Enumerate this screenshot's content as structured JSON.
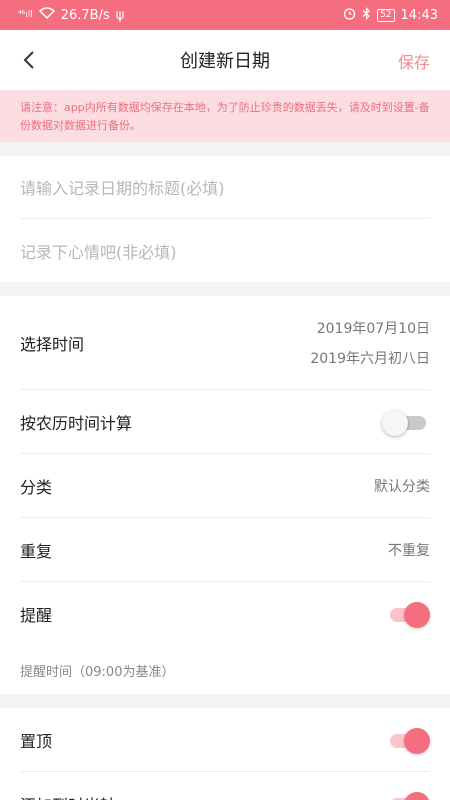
{
  "status_bar": {
    "signal": "⁴⁶ıll",
    "speed": "26.7B/s",
    "usb": "ψ",
    "battery": "52",
    "time": "14:43"
  },
  "app_bar": {
    "title": "创建新日期",
    "save_label": "保存"
  },
  "notice": {
    "text": "请注意：app内所有数据均保存在本地，为了防止珍贵的数据丢失，请及时到设置-备份数据对数据进行备份。"
  },
  "inputs": {
    "title_placeholder": "请输入记录日期的标题(必填)",
    "mood_placeholder": "记录下心情吧(非必填)"
  },
  "settings": {
    "time": {
      "label": "选择时间",
      "solar": "2019年07月10日",
      "lunar": "2019年六月初八日"
    },
    "lunar_calc": {
      "label": "按农历时间计算",
      "on": false
    },
    "category": {
      "label": "分类",
      "value": "默认分类"
    },
    "repeat": {
      "label": "重复",
      "value": "不重复"
    },
    "reminder": {
      "label": "提醒",
      "on": true,
      "note": "提醒时间（09:00为基准）"
    },
    "pin": {
      "label": "置顶",
      "on": true
    },
    "timeline": {
      "label": "添加到时光轴",
      "on": true
    }
  },
  "colors": {
    "accent": "#f56e7f",
    "notice_bg": "#fcdde2",
    "notice_text": "#ea7080"
  }
}
